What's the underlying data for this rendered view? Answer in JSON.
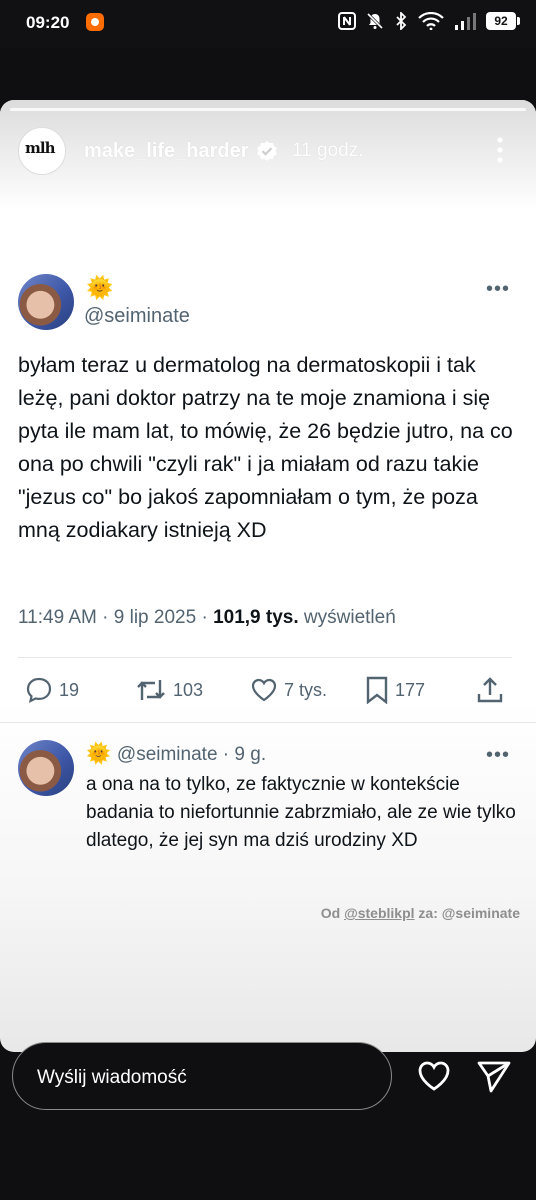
{
  "status_bar": {
    "time": "09:20",
    "battery": "92",
    "icons": [
      "nfc-icon",
      "mute-icon",
      "bluetooth-icon",
      "wifi-icon",
      "signal-icon",
      "battery-icon"
    ]
  },
  "story": {
    "account_logo": "mlh",
    "account_name": "make_life_harder",
    "verified": true,
    "time_ago": "11 godz."
  },
  "tweet": {
    "emoji": "🌞",
    "handle": "@seiminate",
    "text": "byłam teraz u dermatolog na dermatoskopii i tak leżę, pani doktor patrzy na te moje znamiona i się pyta ile mam lat, to mówię, że 26 będzie jutro, na co ona po chwili \"czyli rak\" i ja miałam od razu takie \"jezus co\" bo jakoś zapomniałam o tym, że poza mną zodiakary istnieją XD",
    "time": "11:49 AM",
    "date": "9 lip 2025",
    "views_count": "101,9 tys.",
    "views_label": "wyświetleń",
    "stats": {
      "replies": "19",
      "retweets": "103",
      "likes": "7 tys.",
      "bookmarks": "177"
    }
  },
  "reply": {
    "emoji": "🌞",
    "handle": "@seiminate",
    "time_ago": "9 g.",
    "text": "a ona na to tylko, ze faktycznie w kontekście badania to niefortunnie zabrzmiało, ale ze wie tylko dlatego, że jej syn ma dziś urodziny XD"
  },
  "credit": {
    "prefix": "Od",
    "from": "@steblikpl",
    "middle": "za:",
    "to": "@seiminate"
  },
  "message_bar": {
    "placeholder": "Wyślij wiadomość"
  }
}
